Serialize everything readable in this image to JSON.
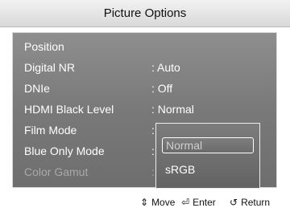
{
  "title": "Picture Options",
  "menu_items": [
    {
      "label": "Position",
      "value": ""
    },
    {
      "label": "Digital NR",
      "value": ": Auto"
    },
    {
      "label": "DNIe",
      "value": ": Off"
    },
    {
      "label": "HDMI Black Level",
      "value": ": Normal"
    },
    {
      "label": "Film Mode",
      "value": ":"
    },
    {
      "label": "Blue Only Mode",
      "value": ":"
    },
    {
      "label": "Color Gamut",
      "value": ":"
    }
  ],
  "dropdown": {
    "options": [
      "Normal",
      "sRGB"
    ],
    "selected": "Normal"
  },
  "footer": {
    "move": "Move",
    "move_icon": "up-down-arrows-icon",
    "enter": "Enter",
    "enter_icon": "enter-key-icon",
    "return": "Return",
    "return_icon": "return-arrow-icon"
  },
  "colors": {
    "panel": "#7f7f7f",
    "text": "#ffffff",
    "disabled_text": "#a9a9a9"
  }
}
